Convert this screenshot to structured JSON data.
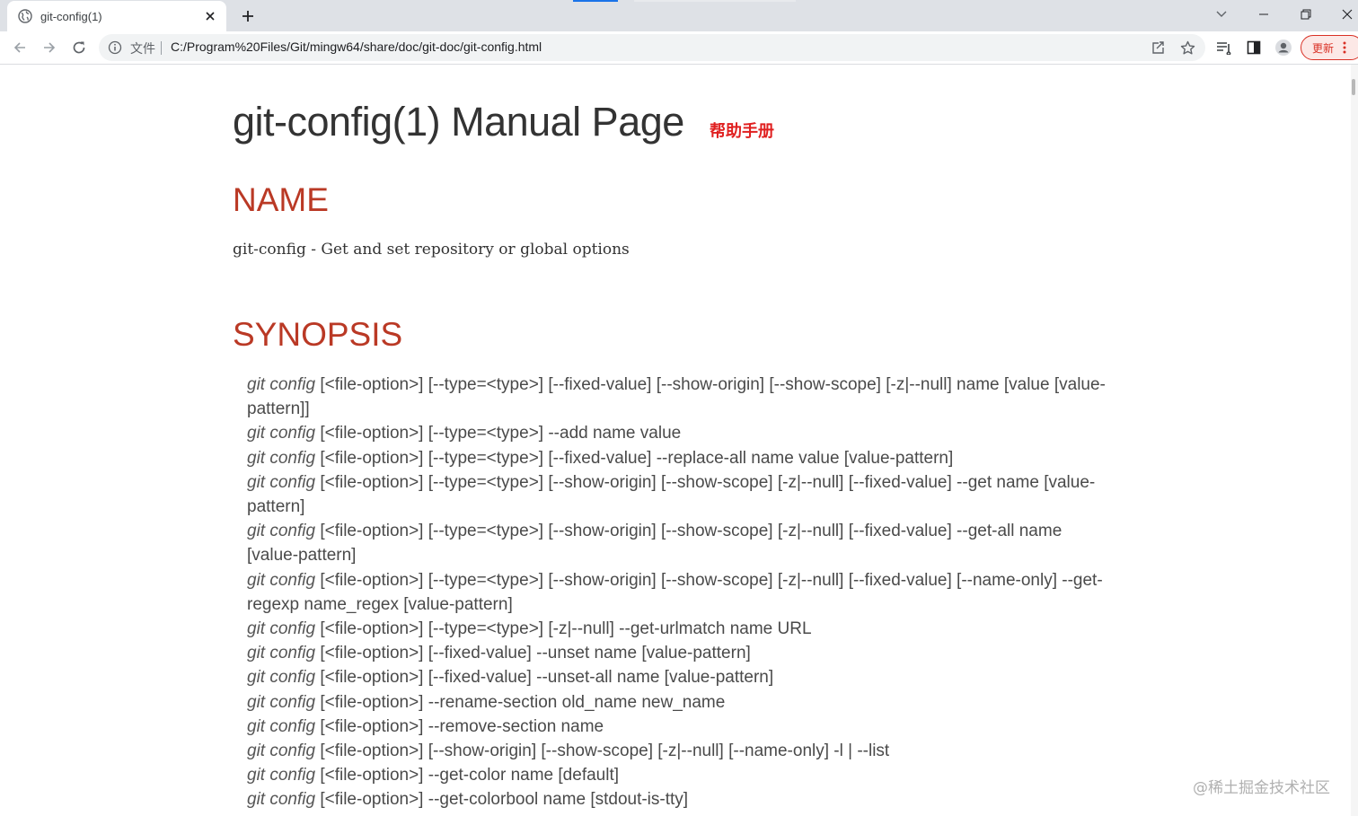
{
  "browser": {
    "tab": {
      "title": "git-config(1)",
      "icon": "globe-icon"
    },
    "omnibox": {
      "scheme_label": "文件",
      "url": "C:/Program%20Files/Git/mingw64/share/doc/git-doc/git-config.html"
    },
    "update_label": "更新"
  },
  "page": {
    "title": "git-config(1) Manual Page",
    "help_link": "帮助手册",
    "sections": {
      "name": {
        "heading": "NAME",
        "text": "git-config - Get and set repository or global options"
      },
      "synopsis": {
        "heading": "SYNOPSIS",
        "command": "git config",
        "lines": [
          "[<file-option>] [--type=<type>] [--fixed-value] [--show-origin] [--show-scope] [-z|--null] name [value [value-pattern]]",
          "[<file-option>] [--type=<type>] --add name value",
          "[<file-option>] [--type=<type>] [--fixed-value] --replace-all name value [value-pattern]",
          "[<file-option>] [--type=<type>] [--show-origin] [--show-scope] [-z|--null] [--fixed-value] --get name [value-pattern]",
          "[<file-option>] [--type=<type>] [--show-origin] [--show-scope] [-z|--null] [--fixed-value] --get-all name [value-pattern]",
          "[<file-option>] [--type=<type>] [--show-origin] [--show-scope] [-z|--null] [--fixed-value] [--name-only] --get-regexp name_regex [value-pattern]",
          "[<file-option>] [--type=<type>] [-z|--null] --get-urlmatch name URL",
          "[<file-option>] [--fixed-value] --unset name [value-pattern]",
          "[<file-option>] [--fixed-value] --unset-all name [value-pattern]",
          "[<file-option>] --rename-section old_name new_name",
          "[<file-option>] --remove-section name",
          "[<file-option>] [--show-origin] [--show-scope] [-z|--null] [--name-only] -l | --list",
          "[<file-option>] --get-color name [default]",
          "[<file-option>] --get-colorbool name [stdout-is-tty]"
        ]
      }
    }
  },
  "watermark": "@稀土掘金技术社区",
  "colors": {
    "section_heading": "#ba3925",
    "help_link": "#e02020",
    "update_accent": "#d93025"
  }
}
